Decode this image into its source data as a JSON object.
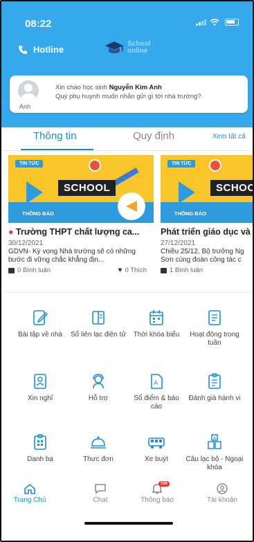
{
  "status": {
    "time": "08:22"
  },
  "header": {
    "hotline_label": "Hotline",
    "logo_line1": "School",
    "logo_line2": "online"
  },
  "greeting": {
    "prefix": "Xin chào học sinh ",
    "student_name": "Nguyễn Kim Anh",
    "subtitle": "Quý phụ huynh muốn nhắn gửi gì tới nhà trường?",
    "avatar_label": "Anh"
  },
  "tabs": {
    "info": "Thông tin",
    "rules": "Quy định",
    "see_all": "Xem tất cả"
  },
  "news": [
    {
      "badge": "TIN TỨC",
      "banner_word": "SCHOOL",
      "banner_sub": "THÔNG BÁO",
      "title": "Trường THPT chất lượng ca...",
      "date": "30/12/2021",
      "desc": "GDVN- Kỳ vọng Nhà trường sẽ có những bước đi vững chắc khẳng địn...",
      "comments": "0 Bình luận",
      "likes": "0 Thích"
    },
    {
      "badge": "TIN TỨC",
      "banner_word": "SCHOOL",
      "banner_sub": "THÔNG BÁO",
      "title": "Phát triển giáo dục và",
      "date": "27/12/2021",
      "desc": "Chiều 25/12, Bộ trưởng Ng Sơn cùng đoàn công tác c",
      "comments": "1 Bình luận"
    }
  ],
  "features": [
    {
      "label": "Bài tập về nhà",
      "icon": "homework-icon"
    },
    {
      "label": "Sổ liên lạc điện tử",
      "icon": "contact-book-icon"
    },
    {
      "label": "Thời khóa biểu",
      "icon": "calendar-icon"
    },
    {
      "label": "Hoạt động trong tuần",
      "icon": "activity-icon"
    },
    {
      "label": "Xin nghỉ",
      "icon": "leave-request-icon"
    },
    {
      "label": "Hỗ trợ",
      "icon": "support-icon"
    },
    {
      "label": "Sổ điểm & báo cáo",
      "icon": "grade-book-icon"
    },
    {
      "label": "Đánh giá hành vi",
      "icon": "behavior-icon"
    },
    {
      "label": "Danh bạ",
      "icon": "directory-icon"
    },
    {
      "label": "Thực đơn",
      "icon": "menu-cloche-icon"
    },
    {
      "label": "Xe buýt",
      "icon": "bus-icon"
    },
    {
      "label": "Câu lạc bộ - Ngoại khóa",
      "icon": "club-icon"
    }
  ],
  "nav": {
    "home": "Trang Chủ",
    "chat": "Chat",
    "notifications": "Thông báo",
    "notif_count": "156",
    "account": "Tài khoản"
  },
  "colors": {
    "primary": "#35a9eb",
    "accent_text": "#1a8fd8",
    "banner_yellow": "#f8c62a",
    "badge_red": "#e53935"
  }
}
